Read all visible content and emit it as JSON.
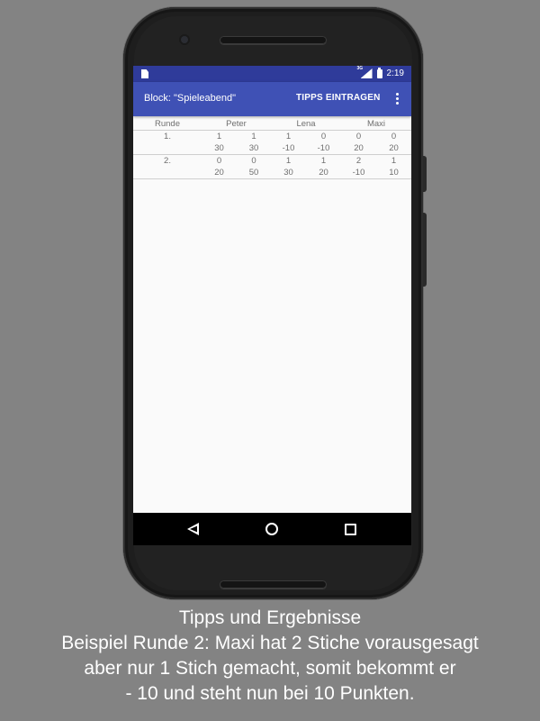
{
  "statusbar": {
    "network": "3G",
    "time": "2:19"
  },
  "appbar": {
    "title": "Block: \"Spieleabend\"",
    "action_label": "TIPPS EINTRAGEN"
  },
  "table": {
    "headers": {
      "round": "Runde",
      "players": [
        "Peter",
        "Lena",
        "Maxi"
      ]
    },
    "rounds": [
      {
        "label": "1.",
        "tipps": [
          "1",
          "1",
          "1",
          "0",
          "0",
          "0"
        ],
        "results": [
          "30",
          "30",
          "-10",
          "-10",
          "20",
          "20"
        ]
      },
      {
        "label": "2.",
        "tipps": [
          "0",
          "0",
          "1",
          "1",
          "2",
          "1"
        ],
        "results": [
          "20",
          "50",
          "30",
          "20",
          "-10",
          "10"
        ]
      }
    ]
  },
  "caption": {
    "line1": "Tipps und Ergebnisse",
    "line2": "Beispiel Runde 2: Maxi hat 2 Stiche vorausgesagt",
    "line3": "aber nur 1 Stich gemacht, somit bekommt er",
    "line4": "- 10 und steht nun bei 10 Punkten."
  },
  "colors": {
    "statusbar": "#2f3b9a",
    "appbar": "#3f51b5",
    "background": "#838383"
  },
  "icons": {
    "status": [
      "sim-card-icon",
      "signal-icon",
      "battery-icon"
    ],
    "nav": [
      "back-icon",
      "home-icon",
      "recents-icon"
    ],
    "menu": "overflow-menu-icon"
  }
}
